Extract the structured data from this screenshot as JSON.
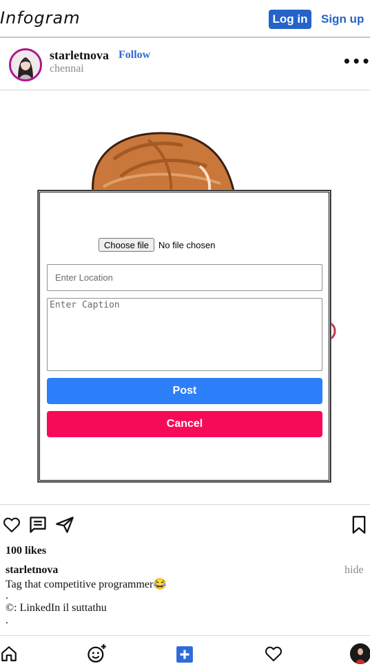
{
  "header": {
    "logo": "Infogram",
    "login_label": "Log in",
    "signup_label": "Sign up"
  },
  "post": {
    "username": "starletnova",
    "follow_label": "Follow",
    "location": "chennai",
    "more_label": "•••",
    "likes": "100 likes",
    "caption_user": "starletnova",
    "hide_label": "hide",
    "caption_lines": [
      "Tag that competitive programmer😂",
      ".",
      "©: LinkedIn il suttathu",
      "."
    ]
  },
  "modal": {
    "file_button_label": "Choose file",
    "file_status": "No file chosen",
    "location_placeholder": "Enter Location",
    "caption_placeholder": "Enter Caption",
    "post_label": "Post",
    "cancel_label": "Cancel"
  },
  "colors": {
    "accent_blue": "#2563c9",
    "post_button": "#2d7ff9",
    "cancel_button": "#f70a58",
    "avatar_ring": "#b0168c",
    "nav_add": "#2d6bd8"
  },
  "icons": {
    "post_actions": [
      "heart-icon",
      "comment-icon",
      "send-icon",
      "bookmark-icon"
    ],
    "bottom_nav": [
      "home-icon",
      "add-emoji-icon",
      "add-post-icon",
      "heart-icon",
      "profile-avatar"
    ]
  }
}
